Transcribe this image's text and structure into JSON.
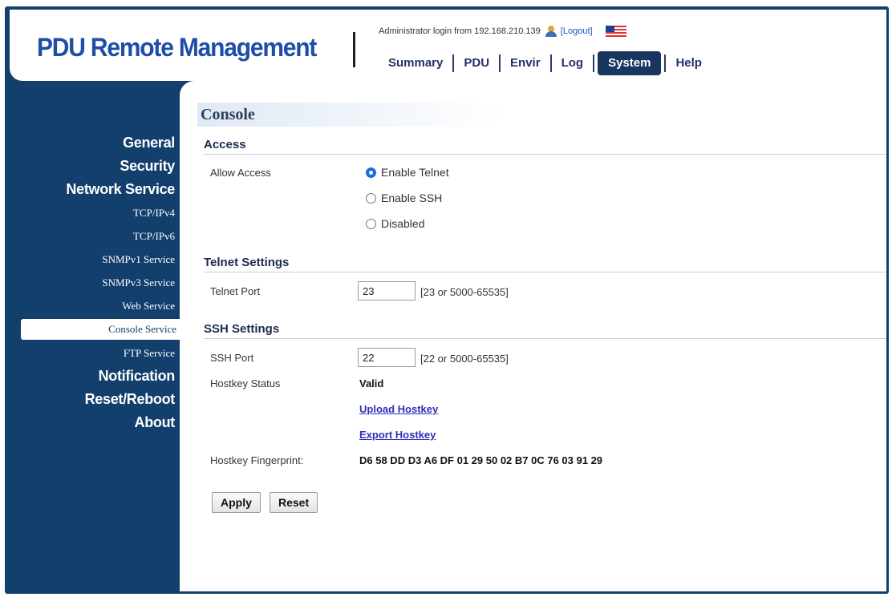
{
  "header": {
    "logo": "PDU Remote Management",
    "login_text": "Administrator login from 192.168.210.139",
    "logout_label": "[Logout]",
    "tabs": [
      {
        "label": "Summary"
      },
      {
        "label": "PDU"
      },
      {
        "label": "Envir"
      },
      {
        "label": "Log"
      },
      {
        "label": "System"
      },
      {
        "label": "Help"
      }
    ],
    "active_tab": "System"
  },
  "sidebar": {
    "items": [
      {
        "label": "General",
        "level": "main"
      },
      {
        "label": "Security",
        "level": "main"
      },
      {
        "label": "Network Service",
        "level": "main"
      },
      {
        "label": "TCP/IPv4",
        "level": "sub"
      },
      {
        "label": "TCP/IPv6",
        "level": "sub"
      },
      {
        "label": "SNMPv1 Service",
        "level": "sub"
      },
      {
        "label": "SNMPv3 Service",
        "level": "sub"
      },
      {
        "label": "Web Service",
        "level": "sub"
      },
      {
        "label": "Console Service",
        "level": "sub",
        "selected": true
      },
      {
        "label": "FTP Service",
        "level": "sub"
      },
      {
        "label": "Notification",
        "level": "main"
      },
      {
        "label": "Reset/Reboot",
        "level": "main"
      },
      {
        "label": "About",
        "level": "main"
      }
    ]
  },
  "console": {
    "title": "Console",
    "access": {
      "heading": "Access",
      "label": "Allow Access",
      "options": [
        {
          "label": "Enable Telnet",
          "checked": true
        },
        {
          "label": "Enable SSH",
          "checked": false
        },
        {
          "label": "Disabled",
          "checked": false
        }
      ]
    },
    "telnet": {
      "heading": "Telnet Settings",
      "port_label": "Telnet Port",
      "port_value": "23",
      "port_hint": "[23 or 5000-65535]"
    },
    "ssh": {
      "heading": "SSH Settings",
      "port_label": "SSH Port",
      "port_value": "22",
      "port_hint": "[22 or 5000-65535]",
      "hostkey_status_label": "Hostkey Status",
      "hostkey_status_value": "Valid",
      "upload_link": "Upload Hostkey",
      "export_link": "Export Hostkey",
      "fingerprint_label": "Hostkey Fingerprint:",
      "fingerprint_value": "D6 58 DD D3 A6 DF 01 29 50 02 B7 0C 76 03 91 29"
    },
    "buttons": {
      "apply": "Apply",
      "reset": "Reset"
    }
  },
  "colors": {
    "navy_background": "#133f6d",
    "logo_blue": "#1e4ea8",
    "active_tab": "#18365f",
    "radio_checked": "#1a6fe0",
    "link": "#2f2fb8"
  }
}
